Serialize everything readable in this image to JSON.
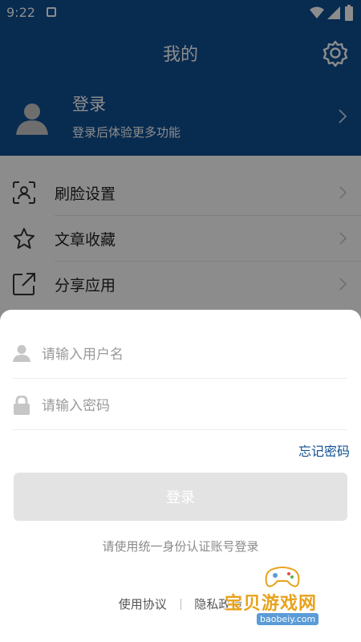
{
  "status_bar": {
    "time": "9:22"
  },
  "header": {
    "title": "我的",
    "login_title": "登录",
    "login_subtitle": "登录后体验更多功能"
  },
  "menu": {
    "items": [
      {
        "label": "刷脸设置",
        "icon": "face-scan-icon"
      },
      {
        "label": "文章收藏",
        "icon": "star-icon"
      },
      {
        "label": "分享应用",
        "icon": "share-icon"
      }
    ]
  },
  "sheet": {
    "username_placeholder": "请输入用户名",
    "password_placeholder": "请输入密码",
    "forgot_password": "忘记密码",
    "login_button": "登录",
    "hint": "请使用统一身份认证账号登录",
    "terms_link": "使用协议",
    "privacy_link": "隐私政策"
  },
  "watermark": {
    "title": "宝贝游戏网",
    "url": "baobeiy.com"
  },
  "colors": {
    "brand": "#0f4f93",
    "button_disabled": "#e3e3e3"
  }
}
